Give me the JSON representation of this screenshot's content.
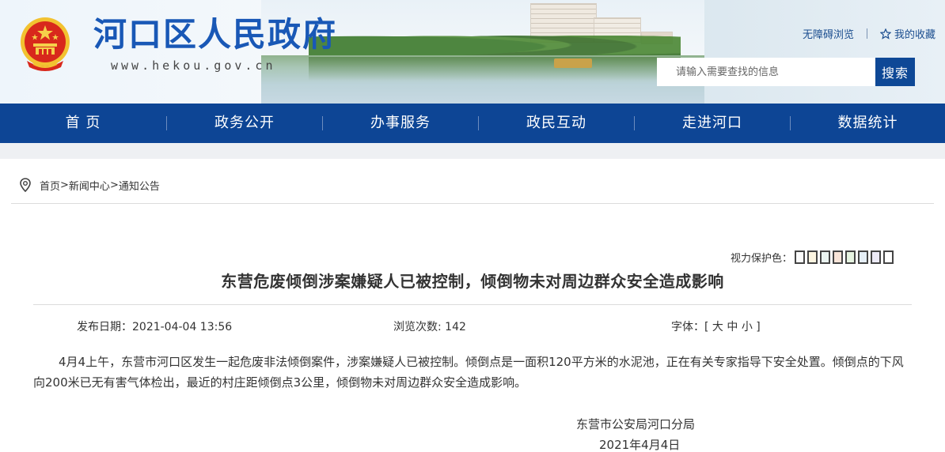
{
  "header": {
    "site_title": "河口区人民政府",
    "site_url": "www.hekou.gov.cn",
    "links": {
      "accessibility": "无障碍浏览",
      "favorites": "我的收藏"
    },
    "search": {
      "placeholder": "请输入需要查找的信息",
      "button_label": "搜索"
    }
  },
  "nav": {
    "items": [
      {
        "label": "首 页"
      },
      {
        "label": "政务公开"
      },
      {
        "label": "办事服务"
      },
      {
        "label": "政民互动"
      },
      {
        "label": "走进河口"
      },
      {
        "label": "数据统计"
      }
    ]
  },
  "breadcrumb": {
    "items": [
      {
        "label": "首页"
      },
      {
        "label": "新闻中心"
      },
      {
        "label": "通知公告"
      }
    ],
    "separator": ">"
  },
  "article": {
    "vision_protect_label": "视力保护色：",
    "vision_colors": [
      "#fafafa",
      "#fbf4e0",
      "#eaf3f0",
      "#f8e4d8",
      "#e6f3e0",
      "#e5eef6",
      "#eceaf6",
      "#ffffff"
    ],
    "title": "东营危废倾倒涉案嫌疑人已被控制，倾倒物未对周边群众安全造成影响",
    "publish_label": "发布日期：",
    "publish_date": "2021-04-04 13:56",
    "views_label": "浏览次数: ",
    "views": "142",
    "font_label": "字体：[ ",
    "font_large": "大",
    "font_medium": "中",
    "font_small": "小",
    "font_close": " ]",
    "body": "4月4上午，东营市河口区发生一起危废非法倾倒案件，涉案嫌疑人已被控制。倾倒点是一面积120平方米的水泥池，正在有关专家指导下安全处置。倾倒点的下风向200米已无有害气体检出，最近的村庄距倾倒点3公里，倾倒物未对周边群众安全造成影响。",
    "signature": "东营市公安局河口分局",
    "sign_date": "2021年4月4日"
  },
  "colors": {
    "brand_blue": "#0d4595",
    "title_blue": "#1958b6"
  }
}
